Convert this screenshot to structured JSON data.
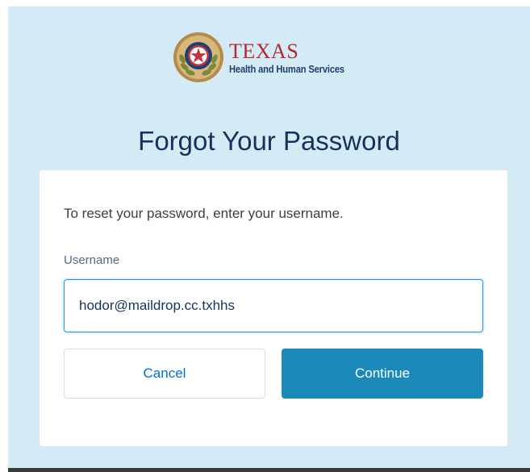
{
  "logo": {
    "title": "TEXAS",
    "subtitle": "Health and Human Services",
    "icon": "texas-seal-icon",
    "colors": {
      "title": "#b02a30",
      "subtitle": "#1f3f77"
    }
  },
  "page": {
    "title": "Forgot Your Password",
    "background": "#d4ebf6"
  },
  "form": {
    "instructions": "To reset your password, enter your username.",
    "username_label": "Username",
    "username_value": "hodor@maildrop.cc.txhhs",
    "cancel_label": "Cancel",
    "continue_label": "Continue",
    "colors": {
      "primary": "#1b8ab8",
      "link": "#0070d2"
    }
  }
}
